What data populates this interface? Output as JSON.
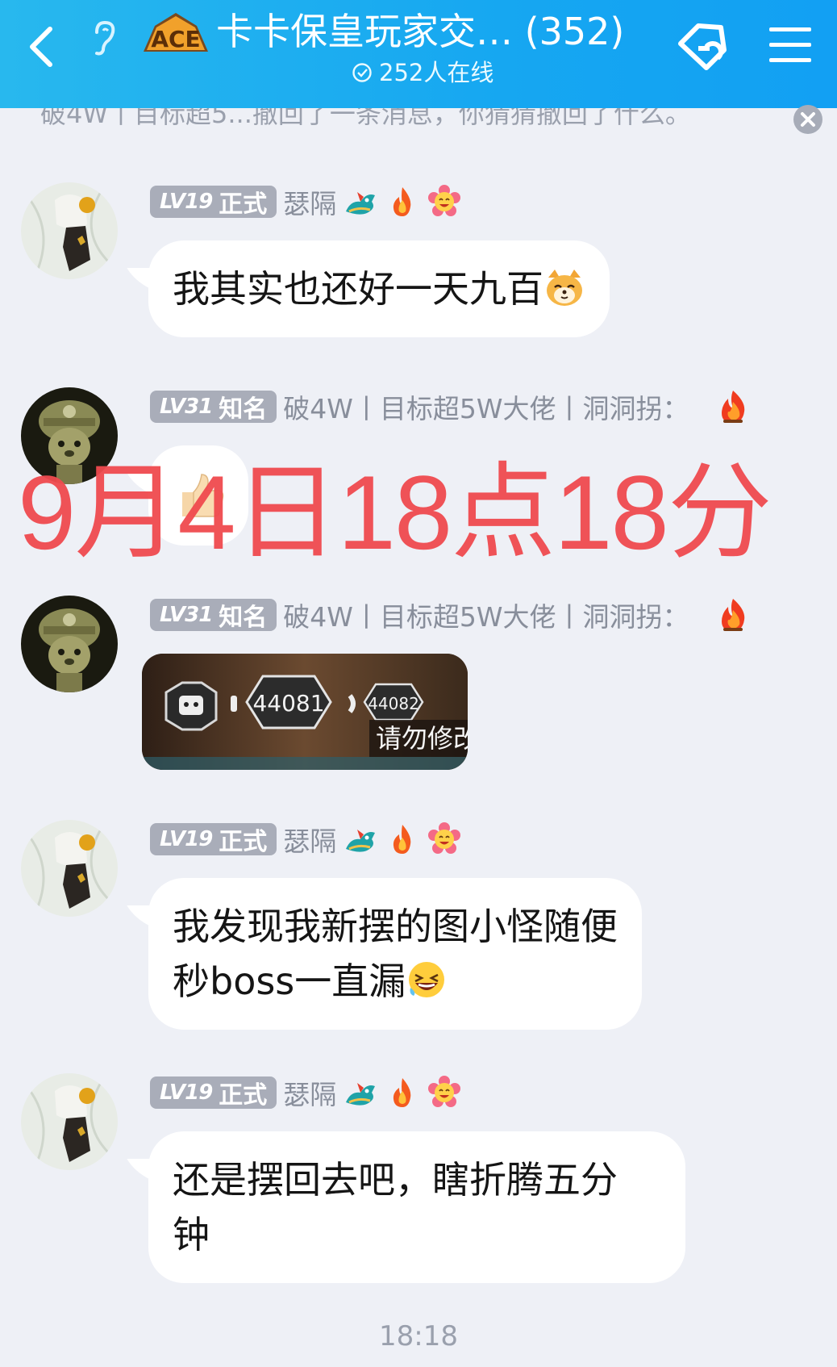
{
  "header": {
    "logo_text": "ACE",
    "title": "卡卡保皇玩家交… (352)",
    "online": "252人在线"
  },
  "notice": {
    "text": "破4W丨目标超5...撤回了一条消息，你猜猜撤回了什么。"
  },
  "overlay_text": "9月4日18点18分",
  "messages": [
    {
      "badge_lv": "LV19",
      "badge_title": "正式",
      "nickname": "瑟隔",
      "text": "我其实也还好一天九百"
    },
    {
      "badge_lv": "LV31",
      "badge_title": "知名",
      "nickname": "破4W丨目标超5W大佬丨洞洞拐：",
      "text": ""
    },
    {
      "badge_lv": "LV31",
      "badge_title": "知名",
      "nickname": "破4W丨目标超5W大佬丨洞洞拐：",
      "image": {
        "hex1": "44081",
        "hex2": "44082",
        "caption": "请勿修改"
      }
    },
    {
      "badge_lv": "LV19",
      "badge_title": "正式",
      "nickname": "瑟隔",
      "line1": "我发现我新摆的图小怪随便",
      "line2": "秒boss一直漏"
    },
    {
      "badge_lv": "LV19",
      "badge_title": "正式",
      "nickname": "瑟隔",
      "line1": "还是摆回去吧，瞎折腾五分",
      "line2": "钟"
    }
  ],
  "timestamp": "18:18",
  "colors": {
    "header_blue": "#16a7f1",
    "overlay_red": "#f04a4f",
    "badge_gray": "#a9adb9"
  }
}
